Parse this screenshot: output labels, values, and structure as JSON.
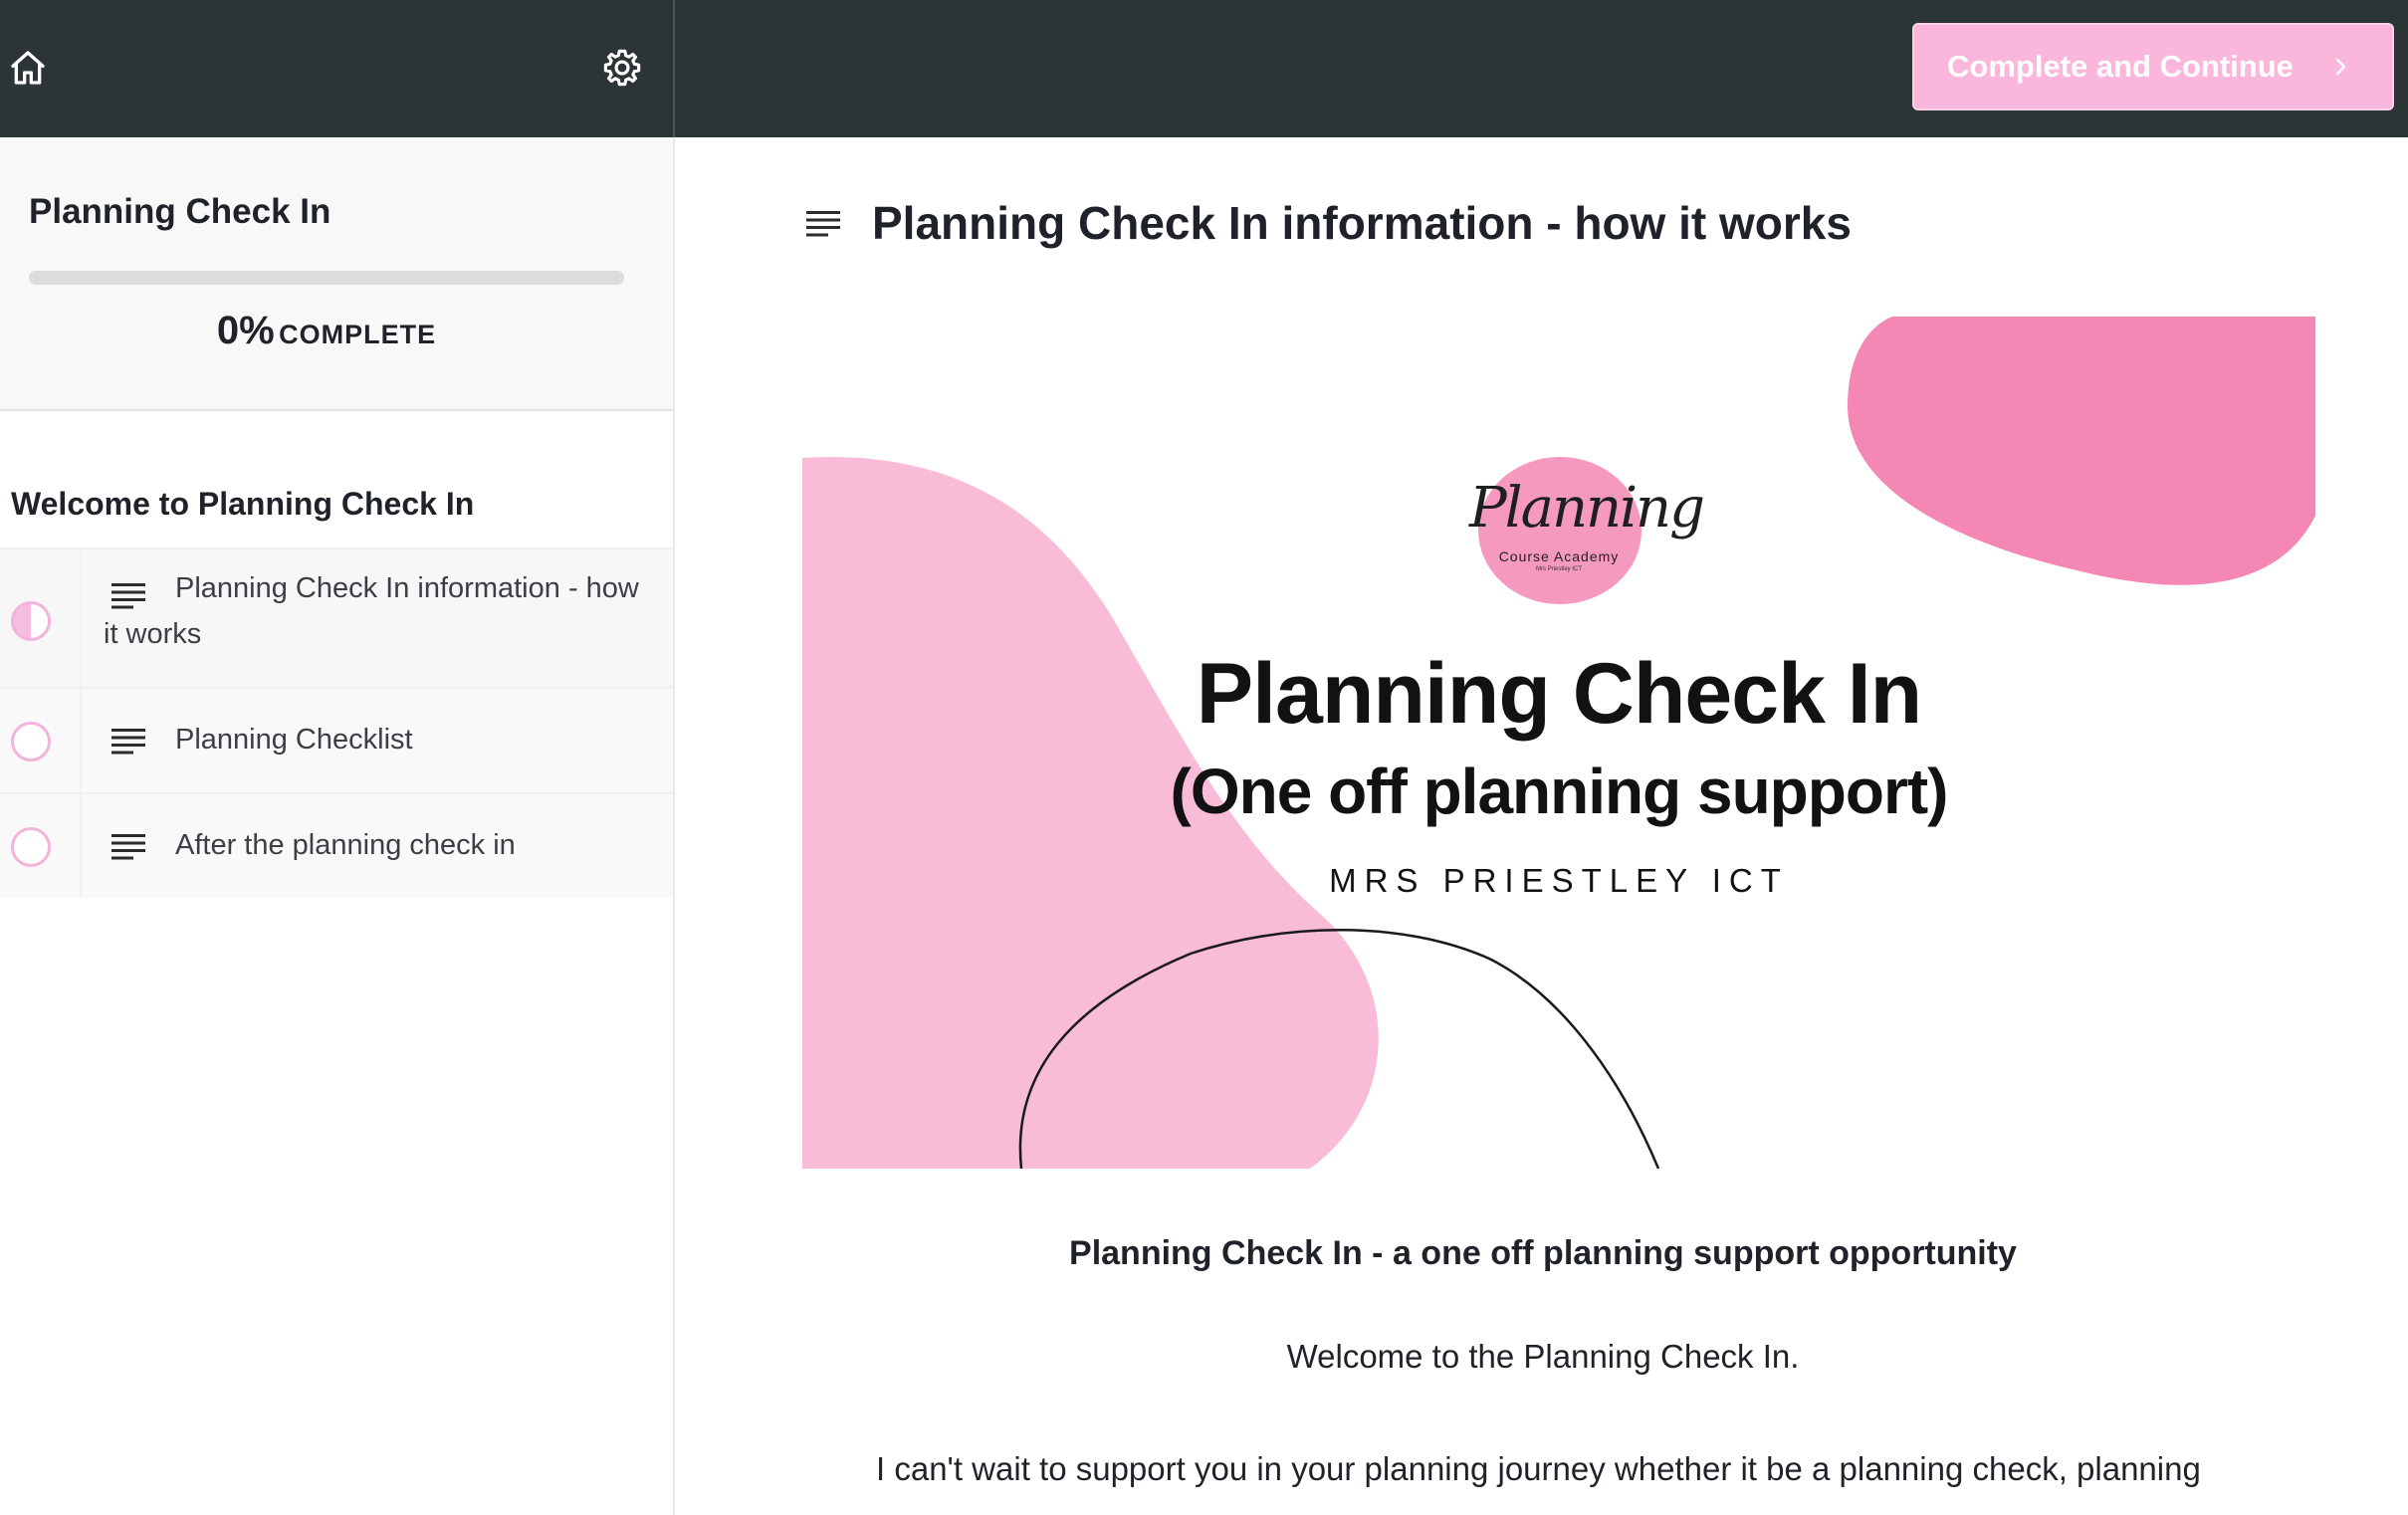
{
  "header": {
    "home_icon": "home-icon",
    "settings_icon": "gear-icon",
    "complete_label": "Complete and Continue",
    "complete_icon": "chevron-right-icon",
    "bar_color": "#2c3536",
    "accent": "#fbb6dc"
  },
  "sidebar": {
    "course_title": "Planning Check In",
    "progress_percent": 0,
    "progress_pct_text": "0%",
    "progress_word": "COMPLETE",
    "section_title": "Welcome to Planning Check In",
    "lessons": [
      {
        "label": "Planning Check In information - how it works",
        "icon": "text-lines-icon",
        "status": "in-progress"
      },
      {
        "label": "Planning Checklist",
        "icon": "text-lines-icon",
        "status": "not-started"
      },
      {
        "label": "After the planning check in",
        "icon": "text-lines-icon",
        "status": "not-started"
      }
    ]
  },
  "main": {
    "title_icon": "text-lines-icon",
    "title": "Planning Check In information - how it works",
    "banner": {
      "logo_script": "Planning",
      "logo_sub": "Course Academy",
      "logo_sub2": "Mrs Priestley ICT",
      "heading": "Planning Check In",
      "subheading": "(One off planning support)",
      "byline": "MRS PRIESTLEY ICT",
      "pink_light": "#f9bcd7",
      "pink_dark": "#f587b4"
    },
    "subheading": "Planning Check In - a one off planning support opportunity",
    "welcome": "Welcome to the Planning Check In.",
    "intro": "I can't wait to support you in your planning journey whether it be a planning check, planning"
  }
}
